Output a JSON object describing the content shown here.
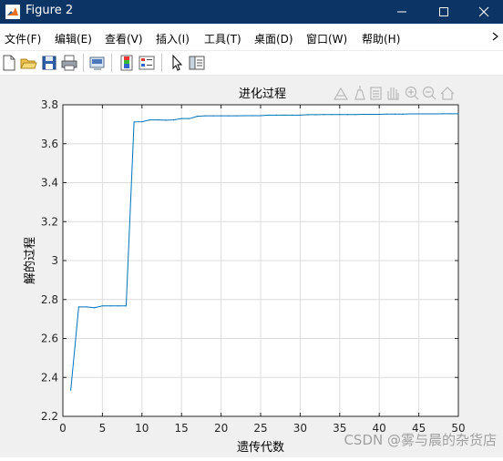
{
  "window": {
    "title": "Figure 2",
    "app_icon": "matlab-icon",
    "controls": [
      "minimize-icon",
      "maximize-icon",
      "close-icon"
    ]
  },
  "menu": {
    "items": [
      "文件(F)",
      "编辑(E)",
      "查看(V)",
      "插入(I)",
      "工具(T)",
      "桌面(D)",
      "窗口(W)",
      "帮助(H)"
    ],
    "overflow_icon": "chevron-right-icon"
  },
  "toolbar": {
    "icons": [
      "new-figure-icon",
      "open-file-icon",
      "save-icon",
      "print-icon",
      "link-plot-icon",
      "insert-colorbar-icon",
      "insert-legend-icon",
      "edit-plot-arrow-icon",
      "property-inspector-icon"
    ]
  },
  "axes_toolbar": {
    "icons": [
      "brush-icon",
      "data-tips-icon",
      "export-icon",
      "pan-hand-icon",
      "zoom-in-icon",
      "zoom-out-icon",
      "home-icon"
    ]
  },
  "chart_data": {
    "type": "line",
    "title": "进化过程",
    "xlabel": "遗传代数",
    "ylabel": "解的过程",
    "xlim": [
      0,
      50
    ],
    "ylim": [
      2.2,
      3.8
    ],
    "xticks": [
      0,
      5,
      10,
      15,
      20,
      25,
      30,
      35,
      40,
      45,
      50
    ],
    "yticks": [
      2.2,
      2.4,
      2.6,
      2.8,
      3,
      3.2,
      3.4,
      3.6,
      3.8
    ],
    "grid": true,
    "color": "#0072bd",
    "x": [
      1,
      2,
      3,
      4,
      5,
      6,
      7,
      8,
      9,
      10,
      11,
      12,
      13,
      14,
      15,
      16,
      17,
      18,
      19,
      20,
      21,
      22,
      23,
      24,
      25,
      26,
      27,
      28,
      29,
      30,
      31,
      32,
      33,
      34,
      35,
      36,
      37,
      38,
      39,
      40,
      41,
      42,
      43,
      44,
      45,
      46,
      47,
      48,
      49,
      50
    ],
    "y": [
      2.335,
      2.762,
      2.762,
      2.758,
      2.767,
      2.767,
      2.767,
      2.767,
      3.712,
      3.713,
      3.722,
      3.722,
      3.721,
      3.722,
      3.729,
      3.729,
      3.741,
      3.743,
      3.743,
      3.743,
      3.743,
      3.743,
      3.744,
      3.744,
      3.744,
      3.747,
      3.747,
      3.747,
      3.747,
      3.747,
      3.749,
      3.749,
      3.75,
      3.75,
      3.75,
      3.75,
      3.75,
      3.751,
      3.751,
      3.751,
      3.752,
      3.752,
      3.752,
      3.753,
      3.753,
      3.753,
      3.753,
      3.754,
      3.754,
      3.754
    ]
  },
  "watermark": "CSDN @雾与晨的杂货店"
}
